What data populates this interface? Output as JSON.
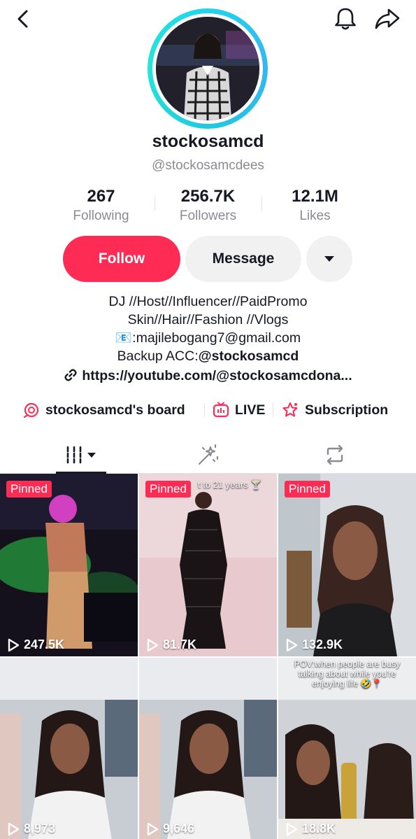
{
  "header": {
    "back_icon": "chevron-left-icon",
    "bell_icon": "bell-icon",
    "share_icon": "share-arrow-icon"
  },
  "profile": {
    "display_name": "stockosamcd",
    "username": "@stockosamcdees",
    "stats": [
      {
        "value": "267",
        "label": "Following"
      },
      {
        "value": "256.7K",
        "label": "Followers"
      },
      {
        "value": "12.1M",
        "label": "Likes"
      }
    ]
  },
  "actions": {
    "follow_label": "Follow",
    "message_label": "Message"
  },
  "bio": {
    "line1": "DJ //Host//Influencer//PaidPromo",
    "line2": "Skin//Hair//Fashion //Vlogs",
    "email_emoji": "📧",
    "line3": ":majilebogang7@gmail.com",
    "line4_prefix": "Backup ACC:",
    "line4_handle": "@stockosamcd",
    "link": "https://youtube.com/@stockosamcdona..."
  },
  "shortcuts": [
    {
      "label": "stockosamcd's board",
      "icon": "board-icon"
    },
    {
      "label": "LIVE",
      "icon": "live-tv-icon"
    },
    {
      "label": "Subscription",
      "icon": "subscription-star-icon"
    }
  ],
  "tabs": [
    "grid-videos-icon",
    "liked-sparkle-icon",
    "reposts-icon"
  ],
  "videos": [
    {
      "pinned": "Pinned",
      "views": "247.5K"
    },
    {
      "pinned": "Pinned",
      "views": "81.7K",
      "caption": "t to 21 years 🍸"
    },
    {
      "pinned": "Pinned",
      "views": "132.9K"
    },
    {
      "views": "8,973"
    },
    {
      "views": "9,646"
    },
    {
      "views": "18.8K",
      "caption": "POV:when people are busy talking about while you're enjoying life 🤣📍"
    }
  ],
  "colors": {
    "accent": "#fe2c55",
    "ring": "#20d5ec",
    "muted": "#8a8b91"
  }
}
